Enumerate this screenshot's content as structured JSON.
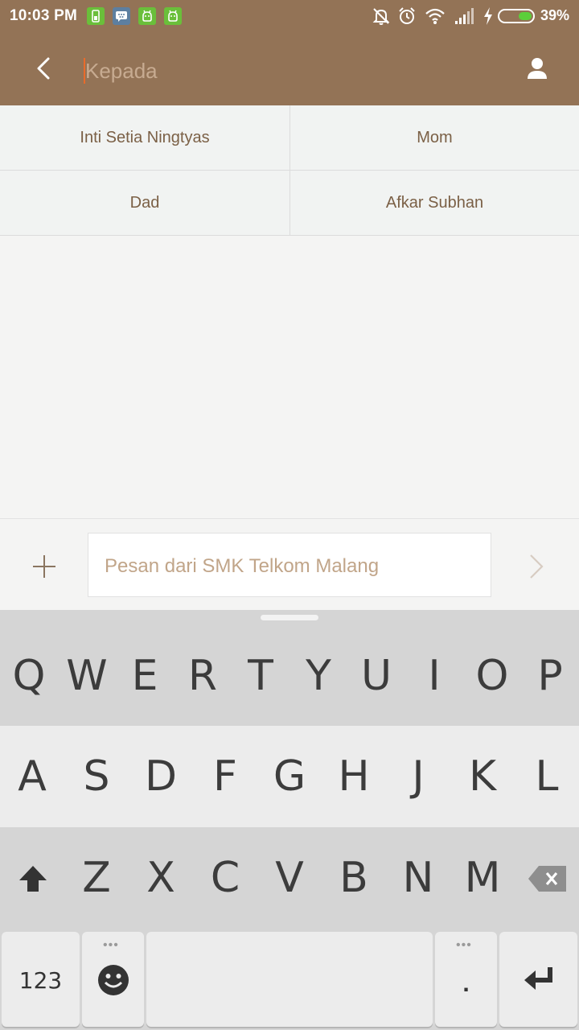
{
  "status_bar": {
    "time": "10:03 PM",
    "battery_percent": "39%",
    "battery_level": 0.39,
    "notification_icons": [
      "battery-notification-icon",
      "bbm-icon",
      "android-icon",
      "android-icon"
    ],
    "system_icons": [
      "mute-bell-icon",
      "alarm-icon",
      "wifi-icon",
      "signal-icon",
      "charging-icon"
    ]
  },
  "header": {
    "to_placeholder": "Kepada",
    "to_value": ""
  },
  "suggestions": [
    {
      "label": "Inti Setia Ningtyas"
    },
    {
      "label": "Mom"
    },
    {
      "label": "Dad"
    },
    {
      "label": "Afkar Subhan"
    }
  ],
  "compose": {
    "placeholder": "Pesan dari SMK Telkom Malang"
  },
  "keyboard": {
    "row1": [
      "Q",
      "W",
      "E",
      "R",
      "T",
      "Y",
      "U",
      "I",
      "O",
      "P"
    ],
    "row2": [
      "A",
      "S",
      "D",
      "F",
      "G",
      "H",
      "J",
      "K",
      "L"
    ],
    "row3": [
      "Z",
      "X",
      "C",
      "V",
      "B",
      "N",
      "M"
    ],
    "numbers_key": "123",
    "period_key": ".",
    "more_dots": "•••"
  },
  "colors": {
    "brand": "#937356",
    "text_brown": "#7b6046",
    "placeholder": "#c1a589",
    "battery_green": "#5ccf3a"
  }
}
